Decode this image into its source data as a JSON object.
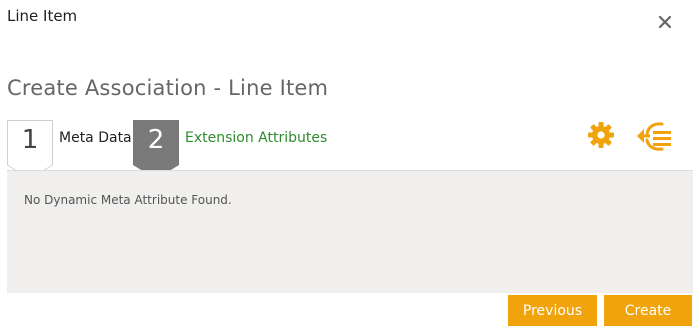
{
  "dialog": {
    "title": "Line Item",
    "close_icon": "close-icon"
  },
  "page": {
    "title": "Create Association - Line Item"
  },
  "wizard": {
    "steps": [
      {
        "number": "1",
        "label": "Meta Data",
        "state": "completed"
      },
      {
        "number": "2",
        "label": "Extension Attributes",
        "state": "active"
      }
    ]
  },
  "toolbar": {
    "icons": [
      "gear-icon",
      "collapse-list-icon"
    ],
    "accent_color": "#f0a30a"
  },
  "content": {
    "empty_message": "No Dynamic Meta Attribute Found."
  },
  "actions": {
    "previous_label": "Previous",
    "create_label": "Create"
  },
  "colors": {
    "button": "#f0a30a",
    "active_step": "#7a7a7a",
    "link": "#2e8b2e",
    "panel": "#f0efed"
  }
}
